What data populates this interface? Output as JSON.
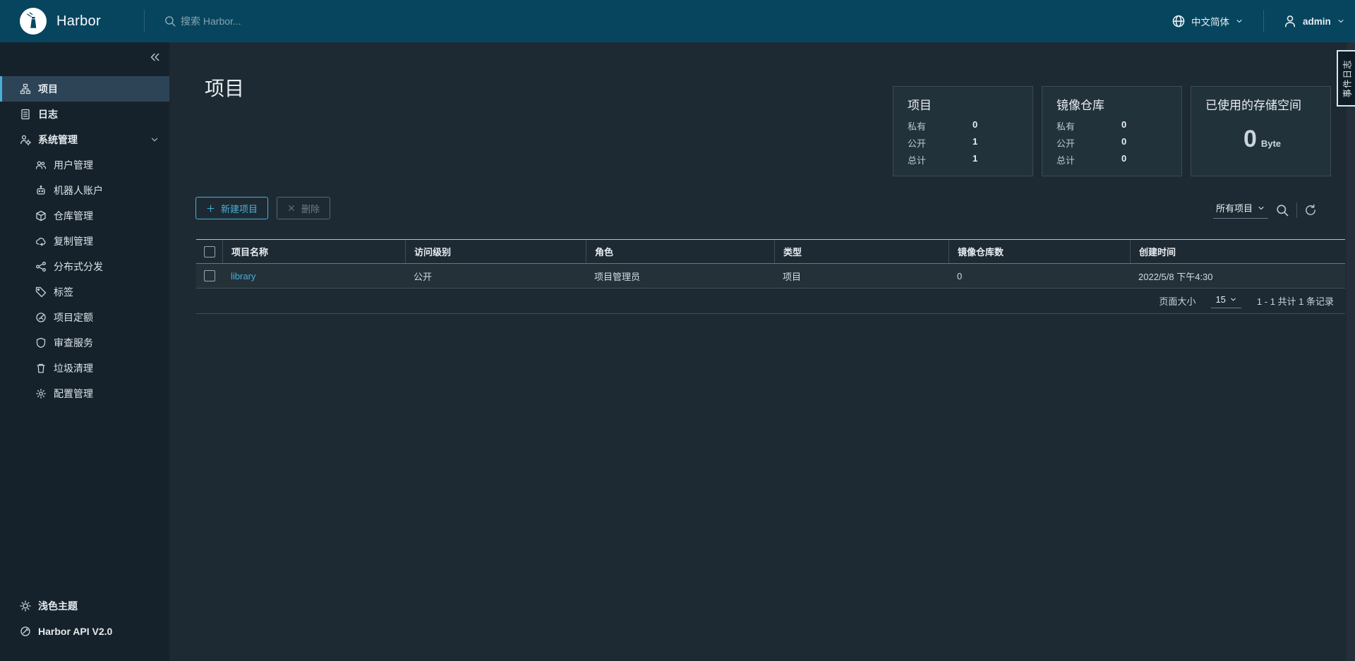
{
  "header": {
    "brand": "Harbor",
    "search_placeholder": "搜索 Harbor...",
    "language": "中文简体",
    "user": "admin"
  },
  "sidebar": {
    "items": {
      "projects": "项目",
      "logs": "日志",
      "administration": "系统管理"
    },
    "admin_subitems": [
      "用户管理",
      "机器人账户",
      "仓库管理",
      "复制管理",
      "分布式分发",
      "标签",
      "项目定额",
      "审查服务",
      "垃圾清理",
      "配置管理"
    ],
    "footer": {
      "theme": "浅色主题",
      "api": "Harbor API V2.0"
    }
  },
  "main": {
    "title": "项目",
    "cards": [
      {
        "title": "项目",
        "rows": [
          [
            "私有",
            "0"
          ],
          [
            "公开",
            "1"
          ],
          [
            "总计",
            "1"
          ]
        ]
      },
      {
        "title": "镜像仓库",
        "rows": [
          [
            "私有",
            "0"
          ],
          [
            "公开",
            "0"
          ],
          [
            "总计",
            "0"
          ]
        ]
      },
      {
        "title": "已使用的存储空间",
        "value": "0",
        "unit": "Byte"
      }
    ],
    "toolbar": {
      "new_project": "新建项目",
      "delete": "删除"
    },
    "filter": {
      "selected": "所有项目"
    },
    "table": {
      "columns": [
        "项目名称",
        "访问级别",
        "角色",
        "类型",
        "镜像仓库数",
        "创建时间"
      ],
      "rows": [
        {
          "name": "library",
          "access": "公开",
          "role": "项目管理员",
          "type": "项目",
          "repo_count": "0",
          "created": "2022/5/8 下午4:30"
        }
      ],
      "footer": {
        "page_size_label": "页面大小",
        "page_size": "15",
        "range": "1 - 1 共计 1 条记录"
      }
    },
    "event_tab": "事件日志"
  },
  "colors": {
    "header_bg": "#07455f",
    "sidebar_bg": "#16222b",
    "content_bg": "#1d2a33",
    "accent": "#49afd9",
    "link": "#4aaed9",
    "active_nav_bg": "#2d4456"
  }
}
